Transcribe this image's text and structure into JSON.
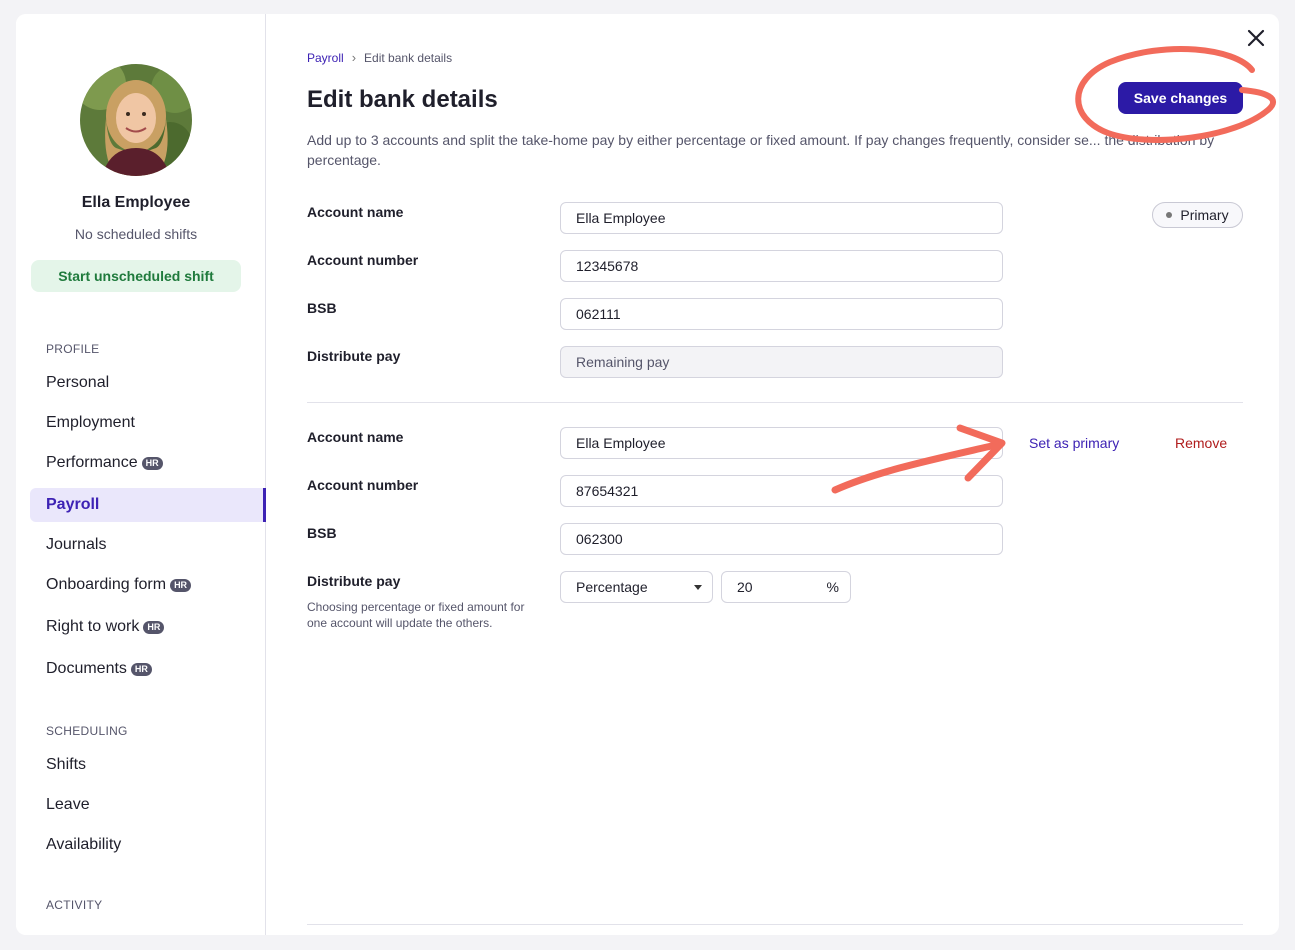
{
  "sidebar": {
    "profile": {
      "name": "Ella Employee",
      "status": "No scheduled shifts",
      "shift_button": "Start unscheduled shift"
    },
    "sections": {
      "profile": "PROFILE",
      "scheduling": "SCHEDULING",
      "activity": "ACTIVITY"
    },
    "items": {
      "personal": "Personal",
      "employment": "Employment",
      "performance": "Performance",
      "payroll": "Payroll",
      "journals": "Journals",
      "onboarding": "Onboarding form",
      "right_to_work": "Right to work",
      "documents": "Documents",
      "shifts": "Shifts",
      "leave": "Leave",
      "availability": "Availability"
    },
    "badge": "HR",
    "active_item": "Payroll"
  },
  "header": {
    "breadcrumb_parent": "Payroll",
    "breadcrumb_current": "Edit bank details",
    "title": "Edit bank details",
    "save_label": "Save changes",
    "description": "Add up to 3 accounts and split the take-home pay by either percentage or fixed amount. If pay changes frequently, consider se... the distribution by percentage."
  },
  "labels": {
    "account_name": "Account name",
    "account_number": "Account number",
    "bsb": "BSB",
    "distribute_pay": "Distribute pay"
  },
  "account1": {
    "account_name": "Ella Employee",
    "account_number": "12345678",
    "bsb": "062111",
    "distribute_pay": "Remaining pay",
    "primary_badge": "Primary"
  },
  "account2": {
    "account_name": "Ella Employee",
    "account_number": "87654321",
    "bsb": "062300",
    "distribute_type": "Percentage",
    "distribute_value": "20",
    "unit": "%",
    "set_primary_label": "Set as primary",
    "remove_label": "Remove",
    "help_text": "Choosing percentage or fixed amount for one account will update the others."
  },
  "colors": {
    "accent": "#2c1aa6",
    "active_nav": "#3d22b4",
    "success_bg": "#e4f5e9",
    "danger": "#b01c1c",
    "annotation": "#f26b5b"
  },
  "icons": {
    "close": "close-icon",
    "breadcrumb_separator": "chevron-right-icon",
    "select_caret": "caret-down-icon"
  }
}
